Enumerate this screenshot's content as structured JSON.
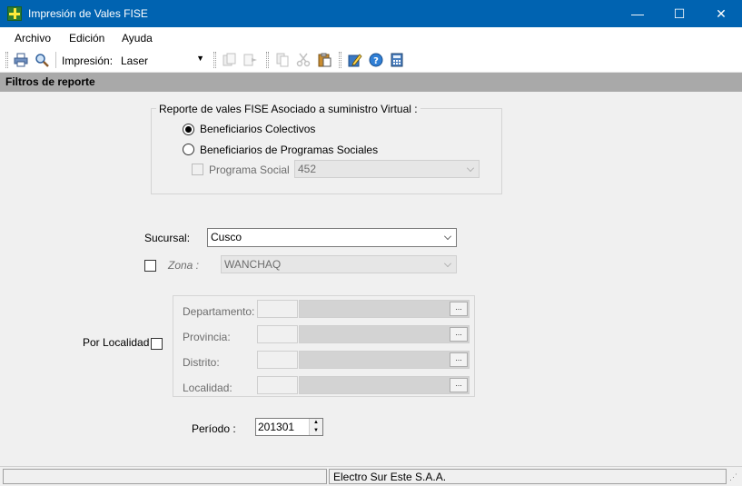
{
  "window": {
    "title": "Impresión de Vales FISE",
    "minimize_glyph": "—",
    "maximize_glyph": "☐",
    "close_glyph": "✕"
  },
  "menu": {
    "items": [
      "Archivo",
      "Edición",
      "Ayuda"
    ]
  },
  "toolbar": {
    "impresion_label": "Impresión:",
    "impresion_value": "Laser",
    "icons": [
      "printer-icon",
      "preview-icon",
      "copy-icon",
      "forward-icon",
      "paste-doc-icon",
      "cut-icon",
      "clipboard-icon",
      "edit-icon",
      "help-icon",
      "calculator-icon"
    ]
  },
  "section": {
    "title": "Filtros de reporte"
  },
  "reporte_group": {
    "title": "Reporte de vales FISE Asociado a suministro Virtual :",
    "option_colectivos": "Beneficiarios Colectivos",
    "option_programas": "Beneficiarios de Programas Sociales",
    "programa_social_label": "Programa Social",
    "programa_social_value": "452",
    "selected": "colectivos"
  },
  "sucursal": {
    "label": "Sucursal:",
    "value": "Cusco"
  },
  "zona": {
    "label": "Zona :",
    "value": "WANCHAQ"
  },
  "localidad": {
    "label": "Por Localidad",
    "fields": [
      {
        "label": "Departamento:",
        "button": "..."
      },
      {
        "label": "Provincia:",
        "button": "..."
      },
      {
        "label": "Distrito:",
        "button": "..."
      },
      {
        "label": "Localidad:",
        "button": "..."
      }
    ]
  },
  "periodo": {
    "label": "Período :",
    "value": "201301"
  },
  "statusbar": {
    "left": "",
    "company": "Electro Sur Este S.A.A."
  },
  "colors": {
    "titlebar": "#0063b1",
    "section_header": "#a9a9a9"
  }
}
